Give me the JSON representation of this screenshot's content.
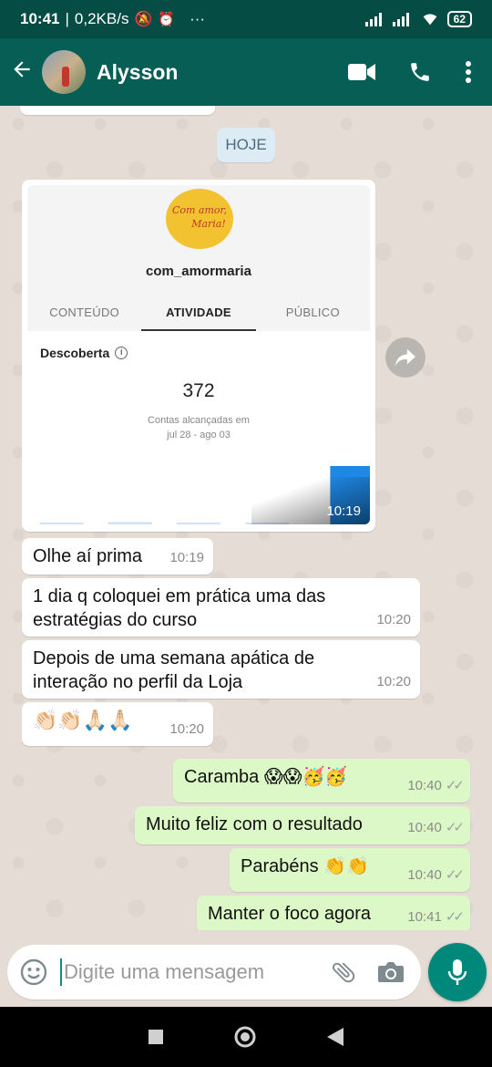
{
  "status_bar": {
    "time": "10:41",
    "speed": "0,2KB/s",
    "battery": "62",
    "more": "···"
  },
  "header": {
    "contact_name": "Alysson"
  },
  "chat": {
    "day_label": "HOJE",
    "image_message": {
      "time": "10:19",
      "screenshot": {
        "logo_text_1": "Com amor,",
        "logo_text_2": "Maria!",
        "username": "com_amormaria",
        "tabs": [
          "CONTEÚDO",
          "ATIVIDADE",
          "PÚBLICO"
        ],
        "active_tab": "ATIVIDADE",
        "section_title": "Descoberta",
        "info_glyph": "i",
        "metric_value": "372",
        "metric_label_1": "Contas alcançadas em",
        "metric_label_2": "jul 28 - ago 03",
        "chart_data": {
          "type": "bar",
          "values": [
            0.02,
            0.04,
            0.02,
            0.02,
            1.0
          ],
          "colors": {
            "bar": "#1e88e5",
            "bar_faint": "#cfe2f7"
          }
        }
      }
    },
    "messages": [
      {
        "id": "m1",
        "dir": "in",
        "text": "Olhe aí prima",
        "time": "10:19"
      },
      {
        "id": "m2",
        "dir": "in",
        "line1": "1 dia q coloquei em prática uma das",
        "line2": "estratégias do curso",
        "time": "10:20"
      },
      {
        "id": "m3",
        "dir": "in",
        "line1": "Depois de uma semana apática de",
        "line2": "interação no perfil da Loja",
        "time": "10:20"
      },
      {
        "id": "m4",
        "dir": "in",
        "text": "👏🏻👏🏻🙏🏻🙏🏻",
        "time": "10:20"
      },
      {
        "id": "m5",
        "dir": "out",
        "text": "Caramba 😱😱🥳🥳",
        "time": "10:40",
        "ticks": "✓✓"
      },
      {
        "id": "m6",
        "dir": "out",
        "text": "Muito feliz com o resultado",
        "time": "10:40",
        "ticks": "✓✓"
      },
      {
        "id": "m7",
        "dir": "out",
        "text": "Parabéns 👏👏",
        "time": "10:40",
        "ticks": "✓✓"
      },
      {
        "id": "m8",
        "dir": "out",
        "text": "Manter o foco agora",
        "time": "10:41",
        "ticks": "✓✓"
      }
    ]
  },
  "composer": {
    "placeholder": "Digite uma mensagem"
  },
  "icons": {
    "back": "arrow-left-icon",
    "video": "video-call-icon",
    "call": "phone-icon",
    "menu": "more-vert-icon",
    "emoji": "emoji-icon",
    "attach": "paperclip-icon",
    "camera": "camera-icon",
    "mic": "microphone-icon",
    "forward": "forward-icon"
  },
  "colors": {
    "header": "#075e54",
    "status_bar": "#054d44",
    "incoming": "#ffffff",
    "outgoing": "#dcf8c6",
    "mic_button": "#00897b"
  }
}
